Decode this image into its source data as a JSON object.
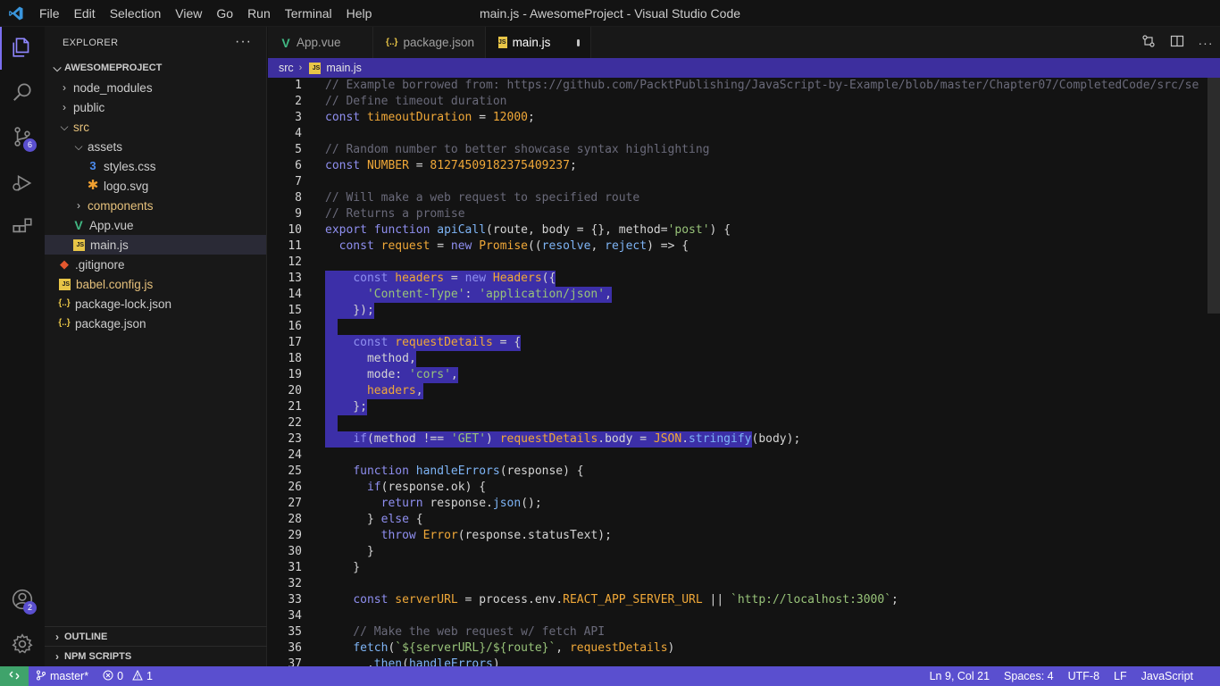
{
  "window": {
    "title": "main.js - AwesomeProject - Visual Studio Code"
  },
  "menu": [
    "File",
    "Edit",
    "Selection",
    "View",
    "Go",
    "Run",
    "Terminal",
    "Help"
  ],
  "activity_bar": {
    "source_control_badge": "6",
    "accounts_badge": "2"
  },
  "sidebar": {
    "title": "EXPLORER",
    "more": "···",
    "root": "AWESOMEPROJECT",
    "tree": [
      {
        "label": "node_modules",
        "type": "folder-collapsed",
        "depth": 1
      },
      {
        "label": "public",
        "type": "folder-collapsed",
        "depth": 1
      },
      {
        "label": "src",
        "type": "folder-open",
        "depth": 1
      },
      {
        "label": "assets",
        "type": "folder-open",
        "depth": 2
      },
      {
        "label": "styles.css",
        "type": "css",
        "depth": 3
      },
      {
        "label": "logo.svg",
        "type": "svg",
        "depth": 3
      },
      {
        "label": "components",
        "type": "folder-collapsed",
        "depth": 2
      },
      {
        "label": "App.vue",
        "type": "vue",
        "depth": 2
      },
      {
        "label": "main.js",
        "type": "js",
        "depth": 2,
        "selected": true
      },
      {
        "label": ".gitignore",
        "type": "git",
        "depth": 1
      },
      {
        "label": "babel.config.js",
        "type": "js",
        "depth": 1
      },
      {
        "label": "package-lock.json",
        "type": "json",
        "depth": 1
      },
      {
        "label": "package.json",
        "type": "json",
        "depth": 1
      }
    ],
    "outline": "OUTLINE",
    "npm_scripts": "NPM SCRIPTS"
  },
  "tabs": [
    {
      "label": "App.vue",
      "icon": "vue-icon",
      "active": false
    },
    {
      "label": "package.json",
      "icon": "json-icon",
      "active": false
    },
    {
      "label": "main.js",
      "icon": "js-icon",
      "active": true,
      "modified": true
    }
  ],
  "breadcrumb": {
    "folder": "src",
    "file": "main.js"
  },
  "editor": {
    "lines": [
      {
        "n": "1",
        "text": "// Example borrowed from: https://github.com/PacktPublishing/JavaScript-by-Example/blob/master/Chapter07/CompletedCode/src/se"
      },
      {
        "n": "2",
        "text": "// Define timeout duration"
      },
      {
        "n": "3",
        "text": "const timeoutDuration = 12000;"
      },
      {
        "n": "4",
        "text": ""
      },
      {
        "n": "5",
        "text": "// Random number to better showcase syntax highlighting"
      },
      {
        "n": "6",
        "text": "const NUMBER = 81274509182375409237;"
      },
      {
        "n": "7",
        "text": ""
      },
      {
        "n": "8",
        "text": "// Will make a web request to specified route"
      },
      {
        "n": "9",
        "text": "// Returns a promise"
      },
      {
        "n": "10",
        "text": "export function apiCall(route, body = {}, method='post') {"
      },
      {
        "n": "11",
        "text": "  const request = new Promise((resolve, reject) => {"
      },
      {
        "n": "12",
        "text": ""
      },
      {
        "n": "13",
        "text": "    const headers = new Headers({"
      },
      {
        "n": "14",
        "text": "      'Content-Type': 'application/json',"
      },
      {
        "n": "15",
        "text": "    });"
      },
      {
        "n": "16",
        "text": ""
      },
      {
        "n": "17",
        "text": "    const requestDetails = {"
      },
      {
        "n": "18",
        "text": "      method,"
      },
      {
        "n": "19",
        "text": "      mode: 'cors',"
      },
      {
        "n": "20",
        "text": "      headers,"
      },
      {
        "n": "21",
        "text": "    };"
      },
      {
        "n": "22",
        "text": ""
      },
      {
        "n": "23",
        "text": "    if(method !== 'GET') requestDetails.body = JSON.stringify(body);"
      },
      {
        "n": "24",
        "text": ""
      },
      {
        "n": "25",
        "text": "    function handleErrors(response) {"
      },
      {
        "n": "26",
        "text": "      if(response.ok) {"
      },
      {
        "n": "27",
        "text": "        return response.json();"
      },
      {
        "n": "28",
        "text": "      } else {"
      },
      {
        "n": "29",
        "text": "        throw Error(response.statusText);"
      },
      {
        "n": "30",
        "text": "      }"
      },
      {
        "n": "31",
        "text": "    }"
      },
      {
        "n": "32",
        "text": ""
      },
      {
        "n": "33",
        "text": "    const serverURL = process.env.REACT_APP_SERVER_URL || `http://localhost:3000`;"
      },
      {
        "n": "34",
        "text": ""
      },
      {
        "n": "35",
        "text": "    // Make the web request w/ fetch API"
      },
      {
        "n": "36",
        "text": "    fetch(`${serverURL}/${route}`, requestDetails)"
      },
      {
        "n": "37",
        "text": "      .then(handleErrors)"
      }
    ]
  },
  "statusbar": {
    "branch": "master*",
    "errors": "0",
    "warnings": "1",
    "cursor": "Ln 9, Col 21",
    "spaces": "Spaces: 4",
    "encoding": "UTF-8",
    "eol": "LF",
    "language": "JavaScript"
  },
  "colors": {
    "accent": "#5a4fcf",
    "selection": "#3c2fa8",
    "breadcrumb_bg": "#3d2f9e",
    "remote": "#3fa36b"
  }
}
